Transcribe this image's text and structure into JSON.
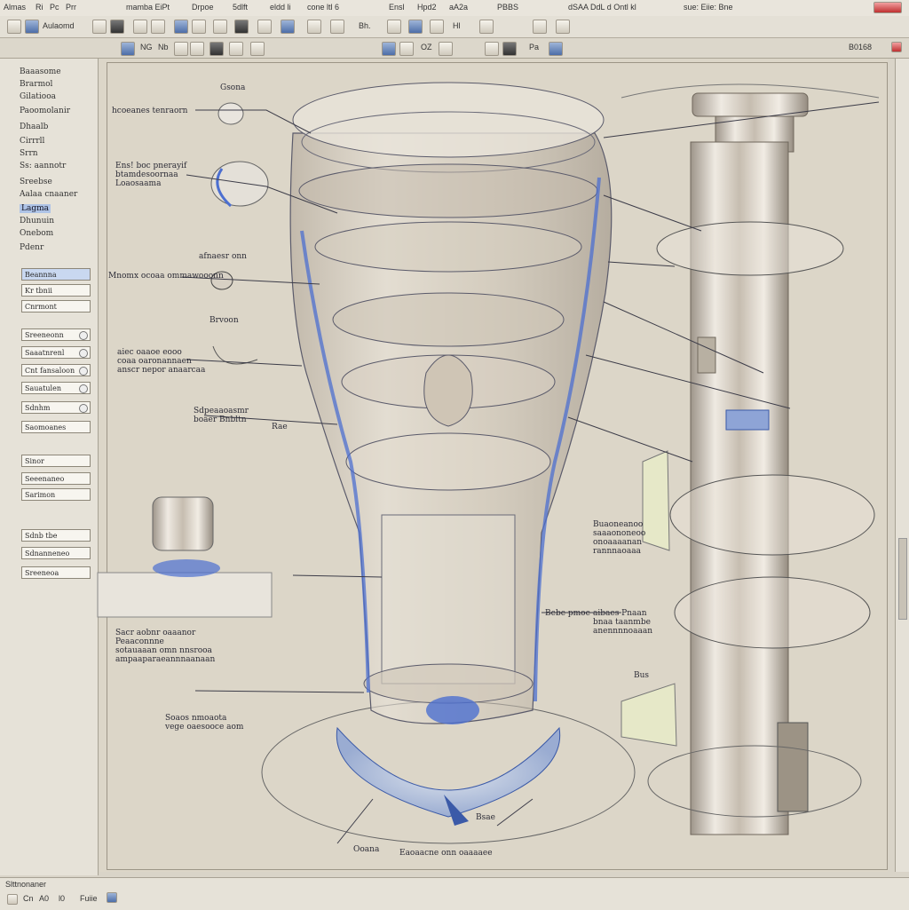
{
  "menubar": {
    "items": [
      "Almas",
      "Ri",
      "Pc",
      "Prr",
      "mamba EiPt",
      "Drpoe",
      "5dlft",
      "eldd li",
      "cone ltl 6",
      "Ensl",
      "Hpd2",
      "aA2a",
      "PBBS",
      "dSAA DdL d Ontl kl",
      "sue: Eiie: Bne"
    ]
  },
  "toolbar1": {
    "labels": [
      "Aulaomd",
      "Bh.",
      "Hl"
    ]
  },
  "toolbar2": {
    "labels": [
      "NG",
      "Nb",
      "OZ",
      "Pa",
      "B0168"
    ]
  },
  "left_panel": {
    "tree": [
      "Baaasome",
      "Brarmol",
      "Gilatiooa",
      "Paoomolanir",
      "Dhaalb",
      "Cirrrll",
      "Srrn",
      "Ss: aannotr",
      "Sreebse",
      "Aalaa cnaaner",
      "Lagma",
      "Dhunuin",
      "Onebom",
      "Pdenr"
    ],
    "selected_tree_index": 10,
    "fields": [
      "Beannna",
      "Kr tbnii",
      "Cnrmont",
      "Sreeneonn",
      "Saaatnrenl",
      "Cnt fansaloon",
      "Sauatulen",
      "Sdnhm",
      "Saomoanes",
      "Sinor",
      "Seeenaneo",
      "Sarimon",
      "Sdnb tbe",
      "Sdnanneneo",
      "Sreeneoa"
    ],
    "selected_field_index": 0
  },
  "callouts": {
    "c1": "Gsona",
    "c2": "hcoeanes tenraorn",
    "c3": "Ens! boc pnerayif\nbtamdesoornaa\nLoaosaama",
    "c4": "afnaesr onn",
    "c5": "Mnomx ocoaa ommawooonn",
    "c6": "Brvoon",
    "c7": "aiec oaaoe eooo\ncoaa oaronannaen\nanscr nepor anaarcaa",
    "c8": "Sdpeaaoasmr\nboaer Bnbltn",
    "c9": "Rae",
    "c10": "Sacr aobnr oaaanor\nPeaaconnne\nsotauaaan omn nnsrooa\nampaaparaeannnaanaan",
    "c11": "Soaos nmoaota\nvege oaesooce aom",
    "c12": "Buaoneanoo\nsaaaononeoo\nonoaaaanan\nrannnaoaaa",
    "c13": "Bebe pmoe",
    "c14": "aibaes Pnaan\nbnaa taanmbe\nanennnnoaaan",
    "c15": "Bsae",
    "c16": "Ooana",
    "c17": "Eaoaacne onn oaaaaee",
    "c18": "Bus"
  },
  "statusbar": {
    "left": "Slttnonaner",
    "items": [
      "Cn",
      "A0",
      "l0",
      "Fuiie"
    ]
  },
  "colors": {
    "accent": "#4c6fd0",
    "metal": "#c9bfae",
    "panel": "#e6e2d8"
  }
}
